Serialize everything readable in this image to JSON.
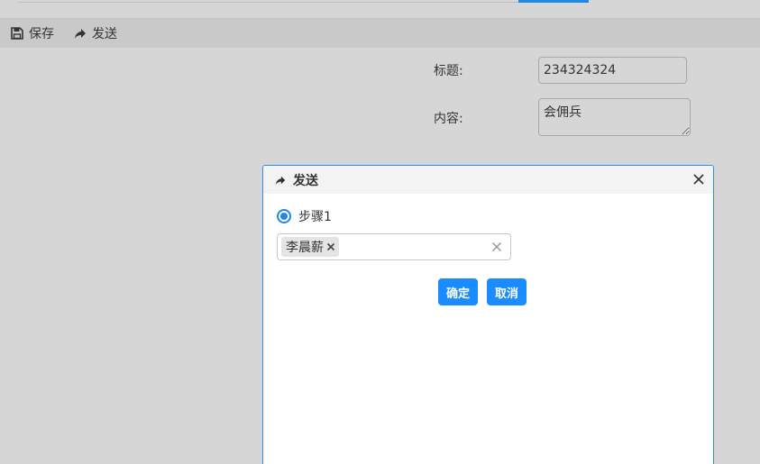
{
  "toolbar": {
    "save_label": "保存",
    "send_label": "发送"
  },
  "form": {
    "title_label": "标题:",
    "title_value": "234324324",
    "content_label": "内容:",
    "content_value": "会佣兵"
  },
  "dialog": {
    "title": "发送",
    "step_label": "步骤1",
    "selected_user": "李晨薪",
    "confirm_label": "确定",
    "cancel_label": "取消"
  },
  "colors": {
    "accent": "#1e88e5",
    "button": "#1a8cff",
    "overlay_bg": "#d6d6d6"
  },
  "icons": {
    "save": "floppy-disk-icon",
    "send": "share-arrow-icon",
    "close": "close-icon",
    "tag_remove": "x-icon",
    "clear": "x-icon"
  }
}
